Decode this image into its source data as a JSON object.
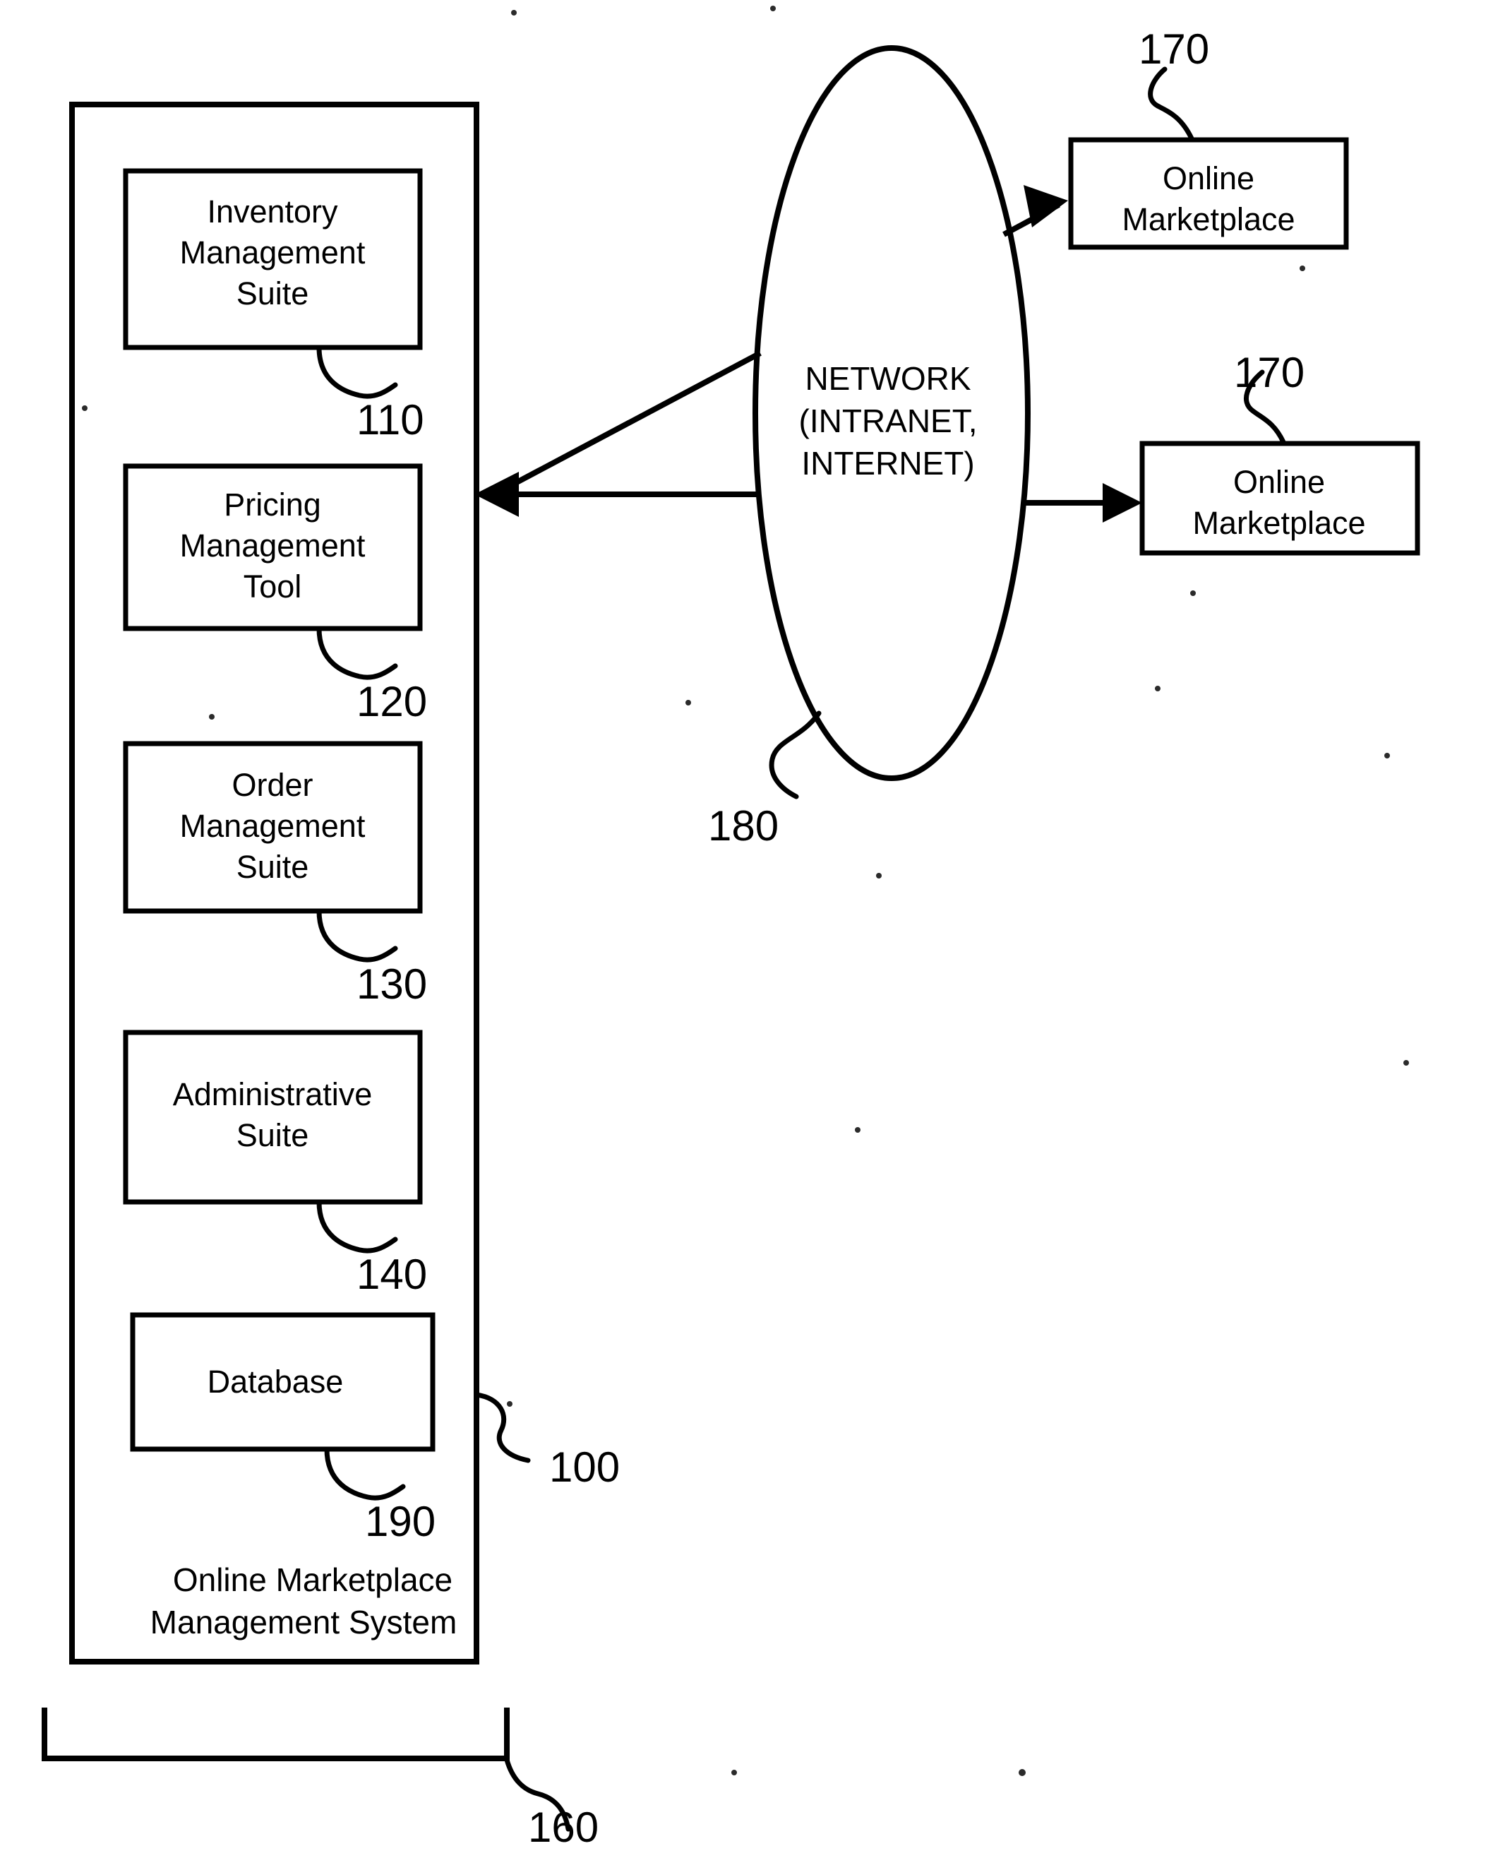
{
  "figure": {
    "title": "Online Marketplace Management System Block Diagram",
    "background_color": "#ffffff",
    "line_color": "#000000"
  },
  "system": {
    "label_line1": "Online Marketplace",
    "label_line2": "Management System",
    "reference_numeral": "100",
    "bracket_reference_numeral": "160",
    "modules": [
      {
        "id": "inventory-management-suite",
        "label_line1": "Inventory",
        "label_line2": "Management",
        "label_line3": "Suite",
        "reference_numeral": "110"
      },
      {
        "id": "pricing-management-tool",
        "label_line1": "Pricing",
        "label_line2": "Management",
        "label_line3": "Tool",
        "reference_numeral": "120"
      },
      {
        "id": "order-management-suite",
        "label_line1": "Order",
        "label_line2": "Management",
        "label_line3": "Suite",
        "reference_numeral": "130"
      },
      {
        "id": "administrative-suite",
        "label_line1": "Administrative",
        "label_line2": "Suite",
        "label_line3": "",
        "reference_numeral": "140"
      },
      {
        "id": "database",
        "label_line1": "Database",
        "label_line2": "",
        "label_line3": "",
        "reference_numeral": "190"
      }
    ]
  },
  "network": {
    "label_line1": "NETWORK",
    "label_line2": "(INTRANET,",
    "label_line3": "INTERNET)",
    "reference_numeral": "180"
  },
  "marketplaces": [
    {
      "id": "online-marketplace-top",
      "label_line1": "Online",
      "label_line2": "Marketplace",
      "reference_numeral": "170"
    },
    {
      "id": "online-marketplace-bottom",
      "label_line1": "Online",
      "label_line2": "Marketplace",
      "reference_numeral": "170"
    }
  ]
}
